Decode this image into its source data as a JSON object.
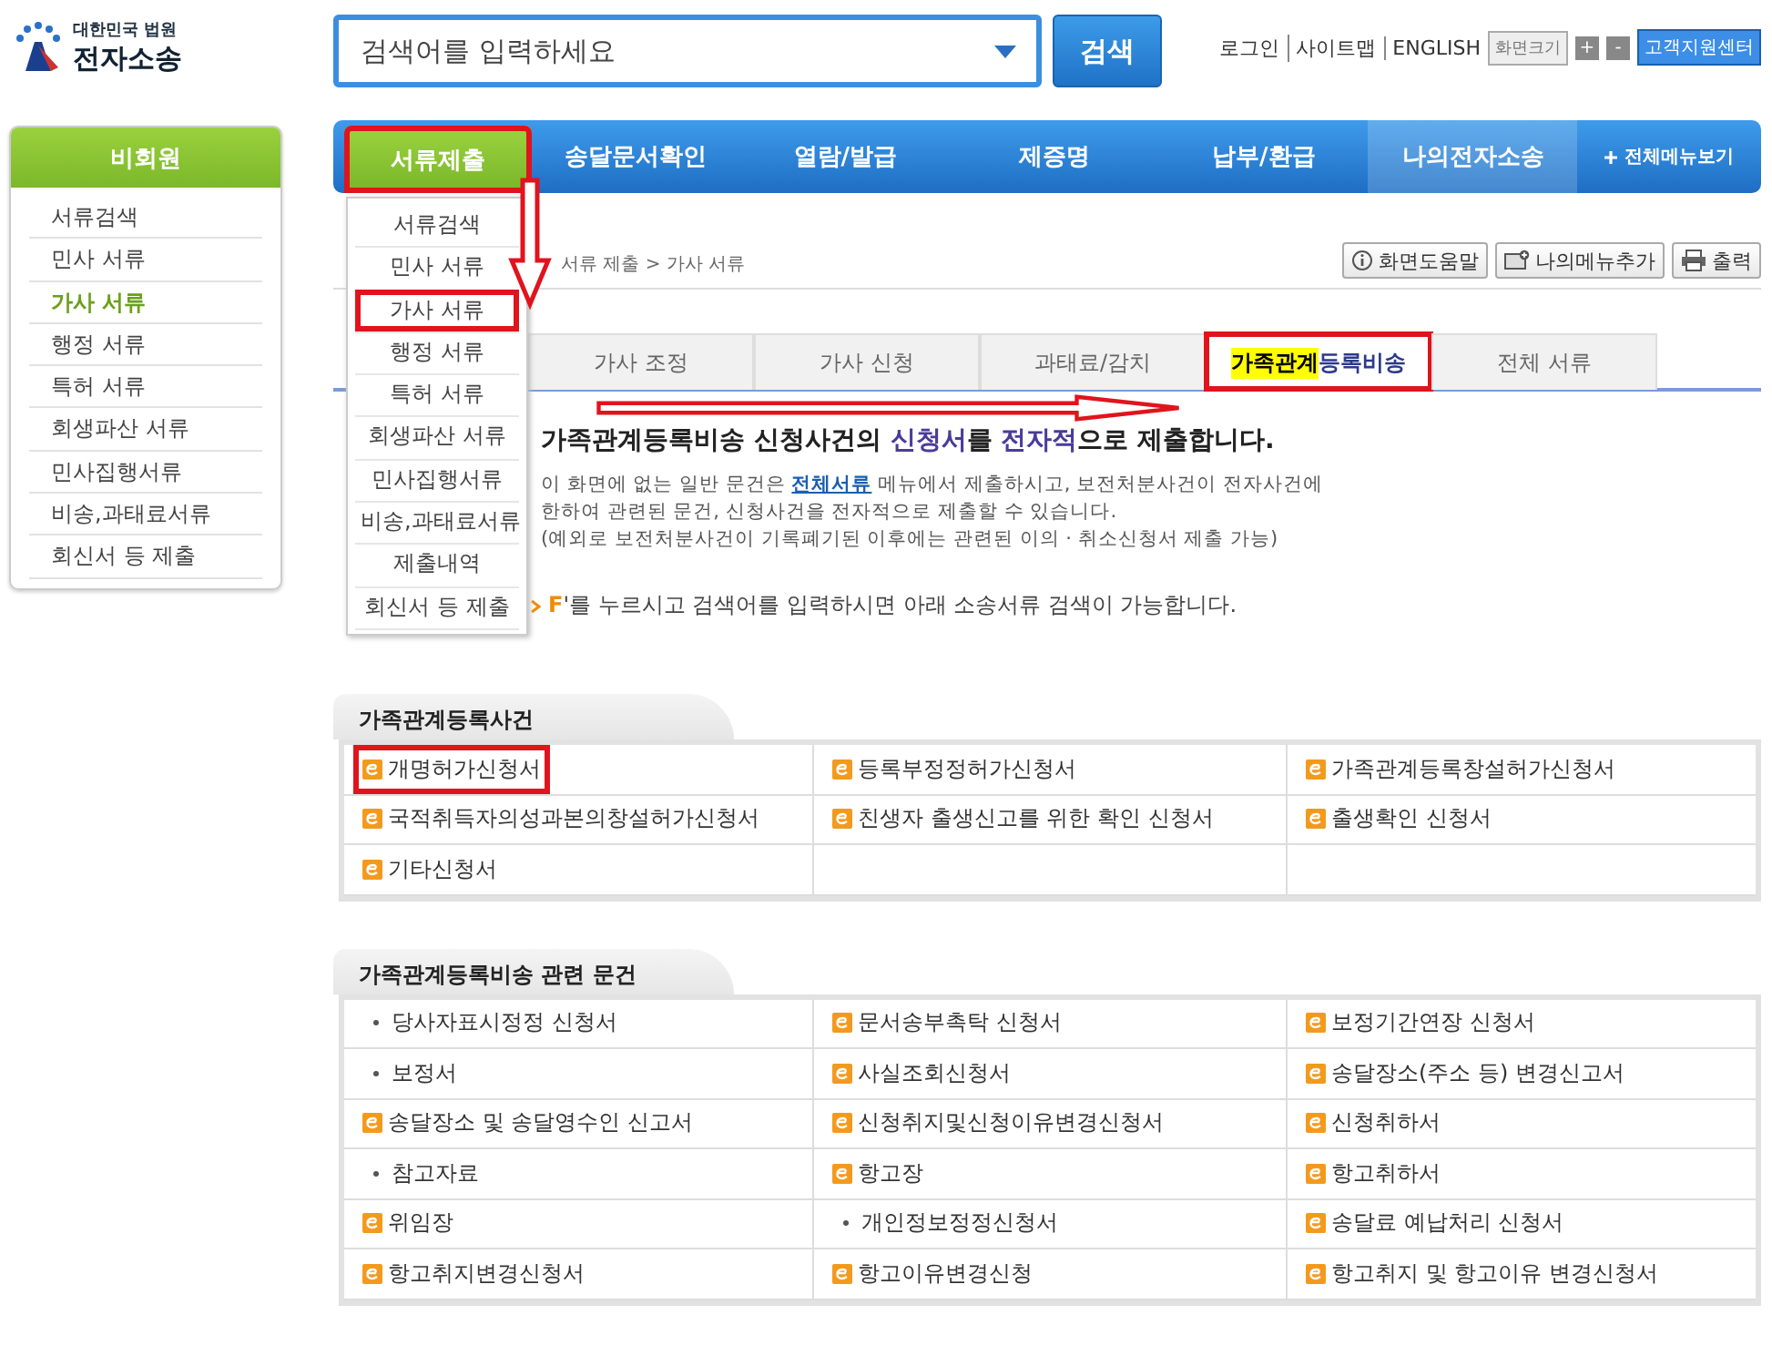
{
  "logo": {
    "org": "대한민국 법원",
    "name": "전자소송"
  },
  "search": {
    "placeholder": "검색어를 입력하세요",
    "button": "검색"
  },
  "top_links": [
    "로그인",
    "사이트맵",
    "ENGLISH"
  ],
  "font_size": {
    "label": "화면크기",
    "increase": "+",
    "decrease": "-"
  },
  "support_button": "고객지원센터",
  "nav": {
    "items": [
      {
        "label": "서류제출",
        "selected": true,
        "highlighted": true
      },
      {
        "label": "송달문서확인",
        "selected": false,
        "highlighted": false
      },
      {
        "label": "열람/발급",
        "selected": false,
        "highlighted": false
      },
      {
        "label": "제증명",
        "selected": false,
        "highlighted": false
      },
      {
        "label": "납부/환급",
        "selected": false,
        "highlighted": false
      },
      {
        "label": "나의전자소송",
        "selected": false,
        "highlighted": false
      }
    ],
    "all_menu": "전체메뉴보기"
  },
  "sidebar": {
    "title": "비회원",
    "items": [
      {
        "label": "서류검색",
        "selected": false
      },
      {
        "label": "민사 서류",
        "selected": false
      },
      {
        "label": "가사 서류",
        "selected": true
      },
      {
        "label": "행정 서류",
        "selected": false
      },
      {
        "label": "특허 서류",
        "selected": false
      },
      {
        "label": "회생파산 서류",
        "selected": false
      },
      {
        "label": "민사집행서류",
        "selected": false
      },
      {
        "label": "비송,과태료서류",
        "selected": false
      },
      {
        "label": "회신서 등 제출",
        "selected": false
      }
    ]
  },
  "dropdown": {
    "items": [
      {
        "label": "서류검색",
        "highlighted": false
      },
      {
        "label": "민사 서류",
        "highlighted": false
      },
      {
        "label": "가사 서류",
        "highlighted": true
      },
      {
        "label": "행정 서류",
        "highlighted": false
      },
      {
        "label": "특허 서류",
        "highlighted": false
      },
      {
        "label": "회생파산 서류",
        "highlighted": false
      },
      {
        "label": "민사집행서류",
        "highlighted": false
      },
      {
        "label": "비송,과태료서류",
        "highlighted": false
      },
      {
        "label": "제출내역",
        "highlighted": false
      },
      {
        "label": "회신서 등 제출",
        "highlighted": false
      }
    ]
  },
  "page": {
    "breadcrumb": "서류 제출 > 가사 서류",
    "actions": [
      {
        "label": "화면도움말",
        "kind": "help"
      },
      {
        "label": "나의메뉴추가",
        "kind": "bookmark"
      },
      {
        "label": "출력",
        "kind": "print"
      }
    ]
  },
  "subtabs": [
    {
      "label": "가사 조정",
      "selected": false,
      "highlighted": false
    },
    {
      "label": "가사 신청",
      "selected": false,
      "highlighted": false
    },
    {
      "label": "과태료/감치",
      "selected": false,
      "highlighted": false
    },
    {
      "label": "**가족관계**등록비송",
      "selected": true,
      "highlighted": true
    },
    {
      "label": "전체 서류",
      "selected": false,
      "highlighted": false
    }
  ],
  "intro": {
    "heading": "가족관계등록비송 신청사건의 **신청서**를 **전자적**으로 제출합니다.",
    "note_before": "이 화면에 없는 일반 문건은 ",
    "note_link": "전체서류",
    "note_after": " 메뉴에서 제출하시고, 보전처분사건이 전자사건에 한하여 관련된 문건, 신청사건을 전자적으로 제출할 수 있습니다.",
    "exception": "(예외로 보전처분사건이 기록폐기된 이후에는 관련된 이의 · 취소신청서 제출 가능)"
  },
  "tip": {
    "key": "F",
    "text": "'를 누르시고 검색어를 입력하시면 아래 소송서류 검색이 가능합니다."
  },
  "sections": [
    {
      "title": "가족관계등록사건",
      "items": [
        {
          "label": "개명허가신청서",
          "kind": "doc",
          "highlighted": true
        },
        {
          "label": "등록부정정허가신청서",
          "kind": "doc",
          "highlighted": false
        },
        {
          "label": "가족관계등록창설허가신청서",
          "kind": "doc",
          "highlighted": false
        },
        {
          "label": "국적취득자의성과본의창설허가신청서",
          "kind": "doc",
          "highlighted": false
        },
        {
          "label": "친생자 출생신고를 위한 확인 신청서",
          "kind": "doc",
          "highlighted": false
        },
        {
          "label": "출생확인 신청서",
          "kind": "doc",
          "highlighted": false
        },
        {
          "label": "기타신청서",
          "kind": "doc",
          "highlighted": false
        }
      ]
    },
    {
      "title": "가족관계등록비송 관련 문건",
      "items": [
        {
          "label": "당사자표시정정 신청서",
          "kind": "bullet",
          "highlighted": false
        },
        {
          "label": "문서송부촉탁 신청서",
          "kind": "doc",
          "highlighted": false
        },
        {
          "label": "보정기간연장 신청서",
          "kind": "doc",
          "highlighted": false
        },
        {
          "label": "보정서",
          "kind": "bullet",
          "highlighted": false
        },
        {
          "label": "사실조회신청서",
          "kind": "doc",
          "highlighted": false
        },
        {
          "label": "송달장소(주소 등) 변경신고서",
          "kind": "doc",
          "highlighted": false
        },
        {
          "label": "송달장소 및 송달영수인 신고서",
          "kind": "doc",
          "highlighted": false
        },
        {
          "label": "신청취지및신청이유변경신청서",
          "kind": "doc",
          "highlighted": false
        },
        {
          "label": "신청취하서",
          "kind": "doc",
          "highlighted": false
        },
        {
          "label": "참고자료",
          "kind": "bullet",
          "highlighted": false
        },
        {
          "label": "항고장",
          "kind": "doc",
          "highlighted": false
        },
        {
          "label": "항고취하서",
          "kind": "doc",
          "highlighted": false
        },
        {
          "label": "위임장",
          "kind": "doc",
          "highlighted": false
        },
        {
          "label": "개인정보정정신청서",
          "kind": "bullet",
          "highlighted": false
        },
        {
          "label": "송달료 예납처리 신청서",
          "kind": "doc",
          "highlighted": false
        },
        {
          "label": "항고취지변경신청서",
          "kind": "doc",
          "highlighted": false
        },
        {
          "label": "항고이유변경신청",
          "kind": "doc",
          "highlighted": false
        },
        {
          "label": "항고취지 및 항고이유 변경신청서",
          "kind": "doc",
          "highlighted": false
        }
      ]
    }
  ]
}
